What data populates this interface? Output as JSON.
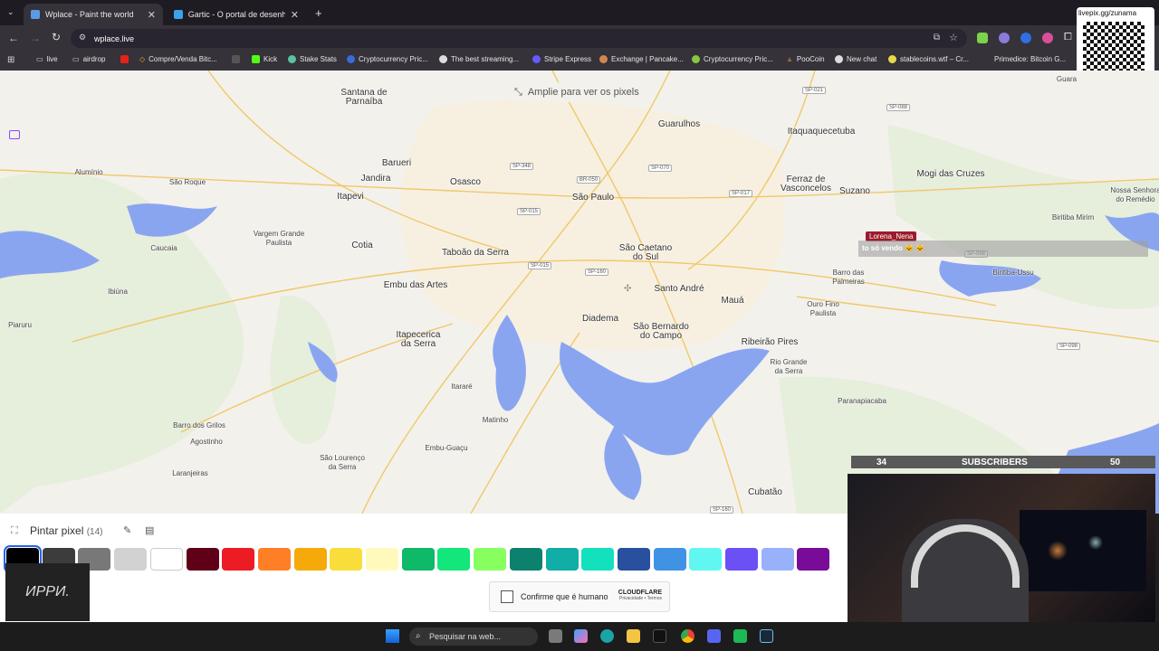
{
  "tabs": [
    {
      "title": "Wplace - Paint the world",
      "active": true
    },
    {
      "title": "Gartic - O portal de desenhos o",
      "active": false
    }
  ],
  "address": {
    "url": "wplace.live"
  },
  "bookmarks": [
    {
      "label": "live",
      "icon": "folder-icon"
    },
    {
      "label": "airdrop",
      "icon": "folder-icon"
    },
    {
      "label": "Compre/Venda Bitc...",
      "icon": "binance-icon"
    },
    {
      "label": "",
      "icon": "stake-icon"
    },
    {
      "label": "Kick",
      "icon": "kick-icon"
    },
    {
      "label": "Stake Stats",
      "icon": "stats-icon"
    },
    {
      "label": "Cryptocurrency Pric...",
      "icon": "coin-icon"
    },
    {
      "label": "The best streaming...",
      "icon": "stream-icon"
    },
    {
      "label": "Stripe Express",
      "icon": "stripe-icon"
    },
    {
      "label": "Exchange | Pancake...",
      "icon": "pancake-icon"
    },
    {
      "label": "Cryptocurrency Pric...",
      "icon": "coin-icon"
    },
    {
      "label": "PooCoin",
      "icon": "poocoin-icon"
    },
    {
      "label": "New chat",
      "icon": "chat-icon"
    },
    {
      "label": "stablecoins.wtf – Cr...",
      "icon": "stable-icon"
    },
    {
      "label": "Primedice: Bitcoin G...",
      "icon": "dice-icon"
    }
  ],
  "map": {
    "zoom_hint": "Amplie para ver os pixels",
    "cities": [
      {
        "name": "Santana de\nParnaíba",
        "size": "big"
      },
      {
        "name": "Guarulhos",
        "size": "big"
      },
      {
        "name": "Itaquaquecetuba",
        "size": "big"
      },
      {
        "name": "Alumínio",
        "size": "small"
      },
      {
        "name": "São Roque",
        "size": "small"
      },
      {
        "name": "Barueri",
        "size": "big"
      },
      {
        "name": "Jandira",
        "size": "big"
      },
      {
        "name": "Osasco",
        "size": "big"
      },
      {
        "name": "Itapevi",
        "size": "big"
      },
      {
        "name": "São Paulo",
        "size": "big"
      },
      {
        "name": "Ferraz de\nVasconcelos",
        "size": "big"
      },
      {
        "name": "Suzano",
        "size": "big"
      },
      {
        "name": "Mogi das Cruzes",
        "size": "big"
      },
      {
        "name": "Nossa Senhora\ndo Remédio",
        "size": "small"
      },
      {
        "name": "Biritiba Mirim",
        "size": "small"
      },
      {
        "name": "Vargem Grande\nPaulista",
        "size": "small"
      },
      {
        "name": "Cotia",
        "size": "big"
      },
      {
        "name": "Taboão da Serra",
        "size": "big"
      },
      {
        "name": "São Caetano\ndo Sul",
        "size": "big"
      },
      {
        "name": "Caucaia",
        "size": "small"
      },
      {
        "name": "Ibiúna",
        "size": "small"
      },
      {
        "name": "Embu das Artes",
        "size": "big"
      },
      {
        "name": "Santo André",
        "size": "big"
      },
      {
        "name": "Barro das\nPalmeiras",
        "size": "small"
      },
      {
        "name": "Biritiba-Ussu",
        "size": "small"
      },
      {
        "name": "Piaruru",
        "size": "small"
      },
      {
        "name": "Mauá",
        "size": "big"
      },
      {
        "name": "Ouro Fino\nPaulista",
        "size": "small"
      },
      {
        "name": "Diadema",
        "size": "big"
      },
      {
        "name": "São Bernardo\ndo Campo",
        "size": "big"
      },
      {
        "name": "Itapecerica\nda Serra",
        "size": "big"
      },
      {
        "name": "Ribeirão Pires",
        "size": "big"
      },
      {
        "name": "Rio Grande\nda Serra",
        "size": "small"
      },
      {
        "name": "Itararé",
        "size": "small"
      },
      {
        "name": "Paranapiacaba",
        "size": "small"
      },
      {
        "name": "Barro dos Grilos",
        "size": "small"
      },
      {
        "name": "Matinho",
        "size": "small"
      },
      {
        "name": "Agostinho",
        "size": "small"
      },
      {
        "name": "Embu-Guaçu",
        "size": "small"
      },
      {
        "name": "São Lourenço\nda Serra",
        "size": "small"
      },
      {
        "name": "Laranjeiras",
        "size": "small"
      },
      {
        "name": "Cubatão",
        "size": "big"
      },
      {
        "name": "Guara",
        "size": "small"
      }
    ],
    "roads": [
      "SP-021",
      "SP-088",
      "SP-348",
      "BR-050",
      "SP-070",
      "SP-017",
      "SP-015",
      "SP-015",
      "SP-160",
      "SP-098",
      "SP-098",
      "SP-160"
    ]
  },
  "chat": {
    "username": "Lorena_Nena",
    "message": "to só vendo 🐱 🐱"
  },
  "qr": {
    "label": "livepix.gg/zunama"
  },
  "paint_panel": {
    "title": "Pintar pixel",
    "count": "(14)",
    "colors": [
      "#000000",
      "#3c3c3c",
      "#787878",
      "#d2d2d2",
      "#ffffff",
      "#600018",
      "#ed1c24",
      "#ff7f27",
      "#f6aa09",
      "#f9dd3b",
      "#fffabc",
      "#0eb968",
      "#13e67b",
      "#87ff5e",
      "#0c816e",
      "#10aea6",
      "#13e1be",
      "#28509e",
      "#4093e4",
      "#60f7f2",
      "#6b50f6",
      "#99b1fb",
      "#780c99",
      "#aa38b9"
    ],
    "selected_index": 0
  },
  "captcha": {
    "label": "Confirme que é humano",
    "brand": "CLOUDFLARE",
    "links": "Privacidade • Termos"
  },
  "stream_overlay": {
    "logo_text": "ИРРИ.",
    "subs_current": "34",
    "subs_label": "SUBSCRIBERS",
    "subs_goal": "50"
  },
  "taskbar": {
    "search_placeholder": "Pesquisar na web..."
  }
}
